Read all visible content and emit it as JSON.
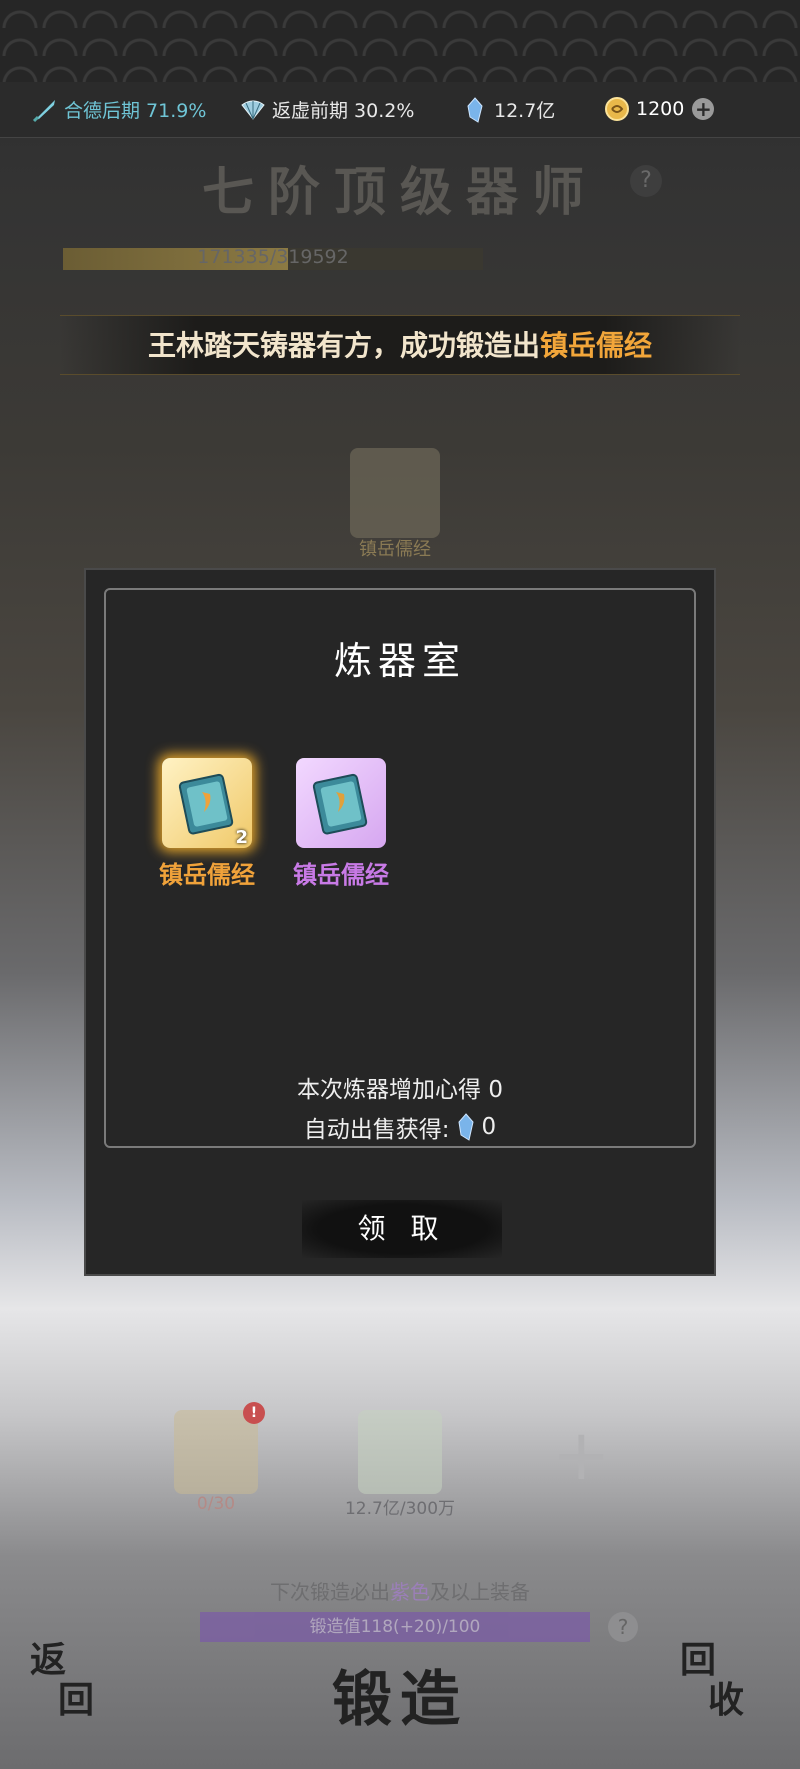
{
  "resources": {
    "cultivation": {
      "icon": "sword-icon",
      "text": "合德后期 71.9%"
    },
    "spirit": {
      "icon": "fan-icon",
      "text": "返虚前期 30.2%"
    },
    "stones": {
      "icon": "crystal-icon",
      "text": "12.7亿"
    },
    "gold": {
      "icon": "coin-icon",
      "text": "1200"
    }
  },
  "background": {
    "rank_title": "七阶顶级器师",
    "exp_text": "171335/319592",
    "exp_fraction": 0.536,
    "banner_prefix": "王林踏天铸器有方，成功锻造出",
    "banner_item": "镇岳儒经",
    "item_label": "镇岳儒经"
  },
  "modal": {
    "title": "炼器室",
    "items": [
      {
        "name": "镇岳儒经",
        "rarity": "gold",
        "count": "2"
      },
      {
        "name": "镇岳儒经",
        "rarity": "purple",
        "count": ""
      }
    ],
    "exp_gain_text": "本次炼器增加心得 0",
    "sell_prefix": "自动出售获得:",
    "sell_value": "0",
    "claim_label": "领 取"
  },
  "bottom": {
    "slot1_label": "0/30",
    "slot2_label": "12.7亿/300万",
    "alert": "!",
    "hint_prefix": "下次锻造必出",
    "hint_highlight": "紫色",
    "hint_suffix": "及以上装备",
    "forge_value_text": "锻造值118(+20)/100",
    "back_line1": "返",
    "back_line2": "回",
    "forge_label": "锻造",
    "recycle_line1": "回",
    "recycle_line2": "收"
  },
  "colors": {
    "accent_gold": "#f0a23a",
    "accent_purple": "#c87ae6",
    "cultivation_teal": "#6fc5d6"
  }
}
